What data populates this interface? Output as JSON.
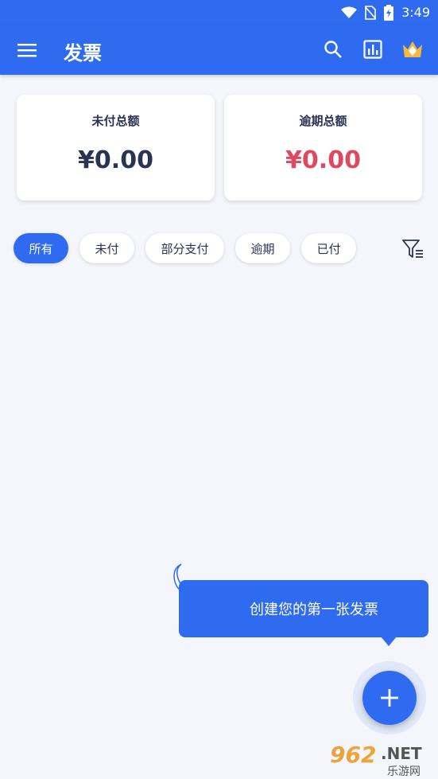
{
  "status_bar": {
    "time": "3:49"
  },
  "app_bar": {
    "title": "发票",
    "icons": [
      "menu-icon",
      "search-icon",
      "bar-chart-icon",
      "crown-icon"
    ]
  },
  "summary": {
    "unpaid": {
      "label": "未付总额",
      "amount": "¥0.00"
    },
    "overdue": {
      "label": "逾期总额",
      "amount": "¥0.00"
    }
  },
  "filters": {
    "chips": [
      "所有",
      "未付",
      "部分支付",
      "逾期",
      "已付"
    ],
    "selected": "所有"
  },
  "empty_state": {
    "hint": "创建您的第一张发票"
  },
  "fab": {
    "label": "+"
  },
  "watermark": {
    "text": "962.NET",
    "sub": "乐游网"
  },
  "colors": {
    "primary": "#2f6bf0",
    "background": "#f4f6fb",
    "text": "#2a3350",
    "overdue": "#e0485f"
  }
}
